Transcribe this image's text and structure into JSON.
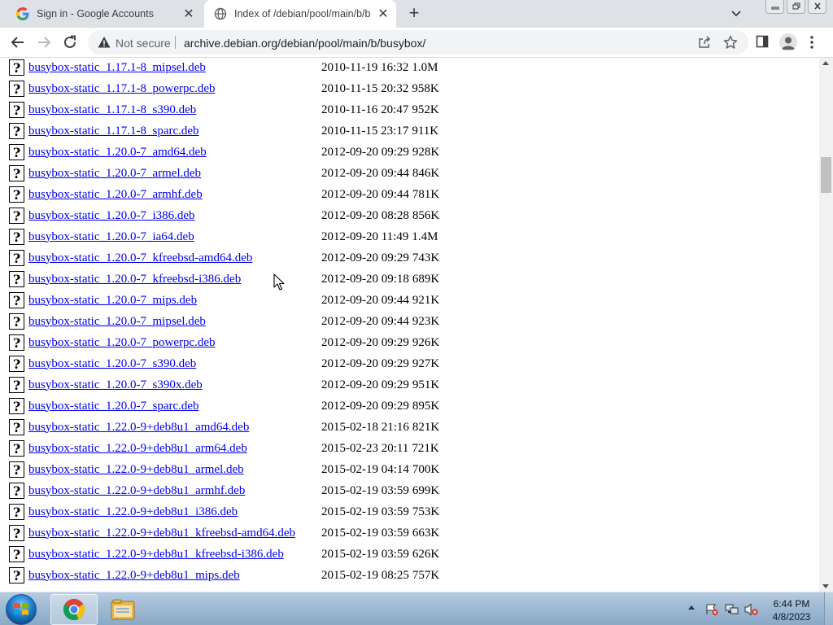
{
  "browser": {
    "tabs": [
      {
        "title": "Sign in - Google Accounts",
        "favicon": "google-g-icon",
        "active": false
      },
      {
        "title": "Index of /debian/pool/main/b/busybox/",
        "favicon": "globe-icon",
        "active": true
      }
    ],
    "omnibox": {
      "security_label": "Not secure",
      "url": "archive.debian.org/debian/pool/main/b/busybox/"
    }
  },
  "listing": {
    "rows": [
      {
        "name": "busybox-static_1.17.1-8_mipsel.deb",
        "date": "2010-11-19 16:32",
        "size": "1.0M"
      },
      {
        "name": "busybox-static_1.17.1-8_powerpc.deb",
        "date": "2010-11-15 20:32",
        "size": "958K"
      },
      {
        "name": "busybox-static_1.17.1-8_s390.deb",
        "date": "2010-11-16 20:47",
        "size": "952K"
      },
      {
        "name": "busybox-static_1.17.1-8_sparc.deb",
        "date": "2010-11-15 23:17",
        "size": "911K"
      },
      {
        "name": "busybox-static_1.20.0-7_amd64.deb",
        "date": "2012-09-20 09:29",
        "size": "928K"
      },
      {
        "name": "busybox-static_1.20.0-7_armel.deb",
        "date": "2012-09-20 09:44",
        "size": "846K"
      },
      {
        "name": "busybox-static_1.20.0-7_armhf.deb",
        "date": "2012-09-20 09:44",
        "size": "781K"
      },
      {
        "name": "busybox-static_1.20.0-7_i386.deb",
        "date": "2012-09-20 08:28",
        "size": "856K"
      },
      {
        "name": "busybox-static_1.20.0-7_ia64.deb",
        "date": "2012-09-20 11:49",
        "size": "1.4M"
      },
      {
        "name": "busybox-static_1.20.0-7_kfreebsd-amd64.deb",
        "date": "2012-09-20 09:29",
        "size": "743K"
      },
      {
        "name": "busybox-static_1.20.0-7_kfreebsd-i386.deb",
        "date": "2012-09-20 09:18",
        "size": "689K"
      },
      {
        "name": "busybox-static_1.20.0-7_mips.deb",
        "date": "2012-09-20 09:44",
        "size": "921K"
      },
      {
        "name": "busybox-static_1.20.0-7_mipsel.deb",
        "date": "2012-09-20 09:44",
        "size": "923K"
      },
      {
        "name": "busybox-static_1.20.0-7_powerpc.deb",
        "date": "2012-09-20 09:29",
        "size": "926K"
      },
      {
        "name": "busybox-static_1.20.0-7_s390.deb",
        "date": "2012-09-20 09:29",
        "size": "927K"
      },
      {
        "name": "busybox-static_1.20.0-7_s390x.deb",
        "date": "2012-09-20 09:29",
        "size": "951K"
      },
      {
        "name": "busybox-static_1.20.0-7_sparc.deb",
        "date": "2012-09-20 09:29",
        "size": "895K"
      },
      {
        "name": "busybox-static_1.22.0-9+deb8u1_amd64.deb",
        "date": "2015-02-18 21:16",
        "size": "821K"
      },
      {
        "name": "busybox-static_1.22.0-9+deb8u1_arm64.deb",
        "date": "2015-02-23 20:11",
        "size": "721K"
      },
      {
        "name": "busybox-static_1.22.0-9+deb8u1_armel.deb",
        "date": "2015-02-19 04:14",
        "size": "700K"
      },
      {
        "name": "busybox-static_1.22.0-9+deb8u1_armhf.deb",
        "date": "2015-02-19 03:59",
        "size": "699K"
      },
      {
        "name": "busybox-static_1.22.0-9+deb8u1_i386.deb",
        "date": "2015-02-19 03:59",
        "size": "753K"
      },
      {
        "name": "busybox-static_1.22.0-9+deb8u1_kfreebsd-amd64.deb",
        "date": "2015-02-19 03:59",
        "size": "663K"
      },
      {
        "name": "busybox-static_1.22.0-9+deb8u1_kfreebsd-i386.deb",
        "date": "2015-02-19 03:59",
        "size": "626K"
      },
      {
        "name": "busybox-static_1.22.0-9+deb8u1_mips.deb",
        "date": "2015-02-19 08:25",
        "size": "757K"
      }
    ]
  },
  "taskbar": {
    "apps": [
      {
        "name": "chrome-icon",
        "active": true
      },
      {
        "name": "file-explorer-icon",
        "active": false
      }
    ],
    "tray_icons": [
      "action-center-icon",
      "network-icon",
      "volume-muted-icon"
    ],
    "clock": {
      "time": "6:44 PM",
      "date": "4/8/2023"
    }
  },
  "colors": {
    "link": "#0000ee",
    "tabstrip_bg": "#dee1e6",
    "omnibox_bg": "#f1f3f4",
    "taskbar_top": "#b7cce0",
    "taskbar_bottom": "#8aa9c6"
  }
}
